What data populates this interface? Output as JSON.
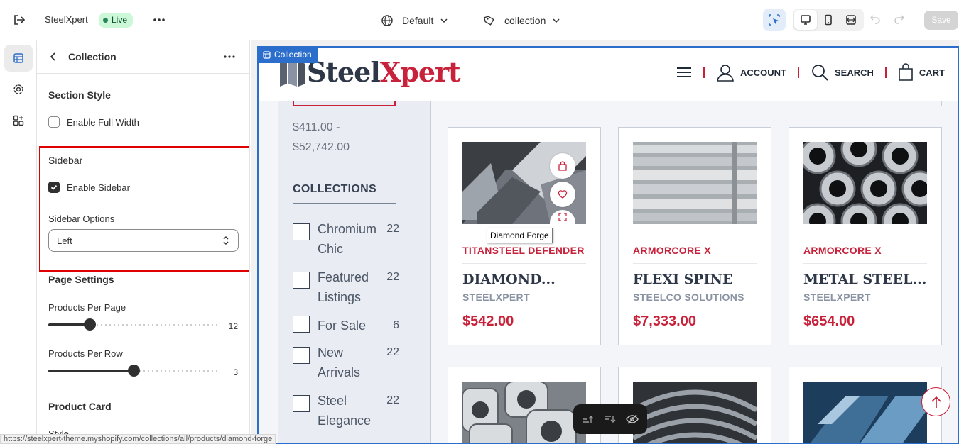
{
  "topbar": {
    "store_name": "SteelXpert",
    "live_badge": "Live",
    "theme_name": "Default",
    "template_name": "collection",
    "save_label": "Save"
  },
  "panel": {
    "title": "Collection",
    "section_style_title": "Section Style",
    "enable_full_width_label": "Enable Full Width",
    "enable_full_width_checked": false,
    "sidebar_title": "Sidebar",
    "enable_sidebar_label": "Enable Sidebar",
    "enable_sidebar_checked": true,
    "sidebar_options_label": "Sidebar Options",
    "sidebar_options_value": "Left",
    "page_settings_title": "Page Settings",
    "products_per_page_label": "Products Per Page",
    "products_per_page_value": "12",
    "products_per_page_fraction": 0.24,
    "products_per_row_label": "Products Per Row",
    "products_per_row_value": "3",
    "products_per_row_fraction": 0.5,
    "product_card_title": "Product Card",
    "style_label": "Style"
  },
  "status_url": "https://steelxpert-theme.myshopify.com/collections/all/products/diamond-forge",
  "preview": {
    "frame_tag": "Collection",
    "logo_part1": "Steel",
    "logo_part2": "Xpert",
    "nav_account": "ACCOUNT",
    "nav_search": "SEARCH",
    "nav_cart": "CART",
    "price_range": "$411.00 - $52,742.00",
    "collections_title": "COLLECTIONS",
    "collections": [
      {
        "name": "Chromium Chic",
        "count": "22"
      },
      {
        "name": "Featured Listings",
        "count": "22"
      },
      {
        "name": "For Sale",
        "count": "6"
      },
      {
        "name": "New Arrivals",
        "count": "22"
      },
      {
        "name": "Steel Elegance",
        "count": "22"
      }
    ],
    "tooltip": "Diamond Forge",
    "products": [
      {
        "tag": "TITANSTEEL DEFENDER",
        "title": "DIAMOND...",
        "vendor": "STEELXPERT",
        "price": "$542.00"
      },
      {
        "tag": "ARMORCORE X",
        "title": "FLEXI SPINE",
        "vendor": "STEELCO SOLUTIONS",
        "price": "$7,333.00"
      },
      {
        "tag": "ARMORCORE X",
        "title": "METAL STEEL...",
        "vendor": "STEELXPERT",
        "price": "$654.00"
      }
    ]
  },
  "colors": {
    "brand_red": "#c8213a",
    "brand_dark": "#2d3748",
    "selection_blue": "#2c6ecb",
    "live_green": "#29845a"
  }
}
